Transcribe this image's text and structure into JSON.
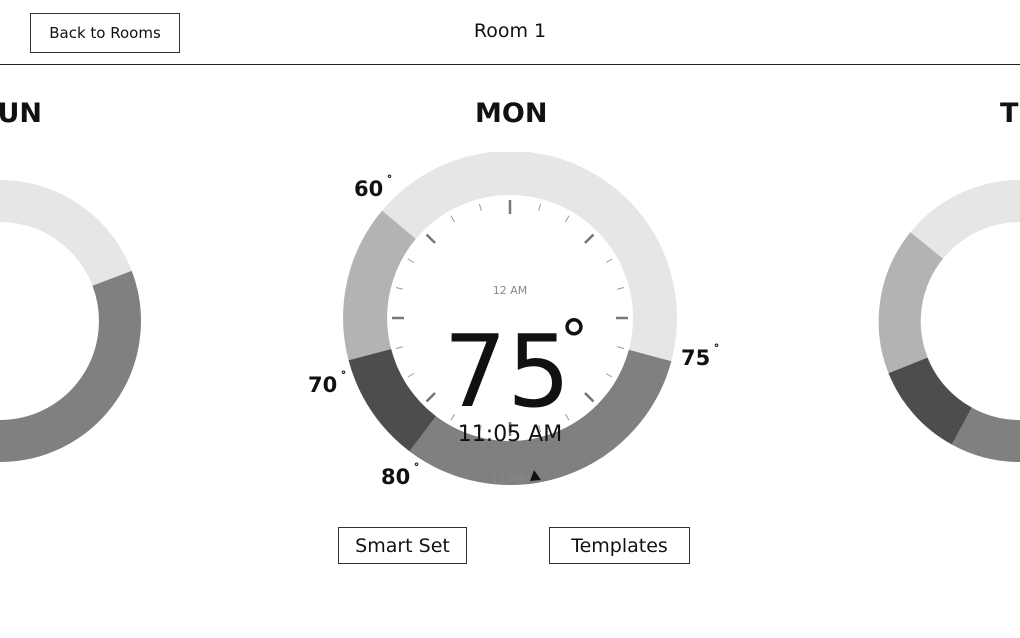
{
  "header": {
    "back_label": "Back to Rooms",
    "room_name": "Room 1"
  },
  "days": {
    "prev": "SUN",
    "current": "MON",
    "next": "TUE"
  },
  "dial": {
    "current_temp": "75",
    "degree_symbol": "°",
    "time": "11:05 AM",
    "top_label": "12 AM",
    "bottom_label": "12 PM"
  },
  "setpoints": {
    "s60": "60",
    "s75": "75",
    "s70": "70",
    "s80": "80"
  },
  "degree": "˚",
  "actions": {
    "smart_set": "Smart Set",
    "templates": "Templates"
  },
  "colors": {
    "light": "#e6e6e6",
    "medium": "#b3b3b3",
    "dark": "#4d4d4d",
    "mid": "#808080"
  }
}
